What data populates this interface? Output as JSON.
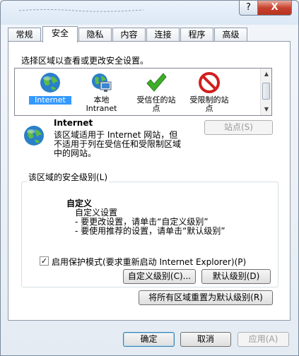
{
  "window": {
    "help_label": "?",
    "close_label": "X"
  },
  "tabs": [
    {
      "label": "常规"
    },
    {
      "label": "安全"
    },
    {
      "label": "隐私"
    },
    {
      "label": "内容"
    },
    {
      "label": "连接"
    },
    {
      "label": "程序"
    },
    {
      "label": "高级"
    }
  ],
  "security": {
    "zone_prompt": "选择区域以查看或更改安全设置。",
    "zones": [
      {
        "line1": "Internet",
        "line2": "",
        "icon": "globe-icon"
      },
      {
        "line1": "本地",
        "line2": "Intranet",
        "icon": "intranet-icon"
      },
      {
        "line1": "受信任的站",
        "line2": "点",
        "icon": "checkmark-icon"
      },
      {
        "line1": "受限制的站",
        "line2": "点",
        "icon": "no-entry-icon"
      }
    ],
    "selected_zone_title": "Internet",
    "selected_zone_desc": [
      "该区域适用于 Internet 网站，但",
      "不适用于列在受信任和受限制区域",
      "中的网站。"
    ],
    "sites_button": "站点(S)",
    "level_group_label": "该区域的安全级别(L)",
    "level_name": "自定义",
    "level_desc": [
      "自定义设置",
      "- 要更改设置，请单击“自定义级别”",
      "- 要使用推荐的设置，请单击“默认级别”"
    ],
    "protected_mode_label": "启用保护模式(要求重新启动 Internet Explorer)(P)",
    "protected_mode_checked": true,
    "custom_level_button": "自定义级别(C)...",
    "default_level_button": "默认级别(D)",
    "reset_all_button": "将所有区域重置为默认级别(R)"
  },
  "footer": {
    "ok_button": "确定",
    "cancel_button": "取消",
    "apply_button": "应用(A)"
  },
  "colors": {
    "selection": "#3399ff",
    "tab_border": "#8e9aaa"
  }
}
